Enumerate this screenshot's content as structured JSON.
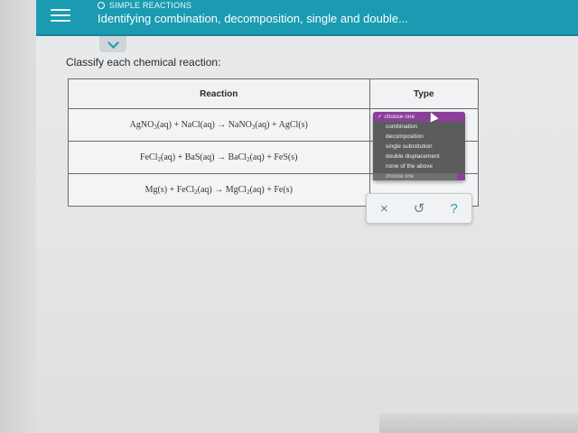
{
  "header": {
    "topic_label": "SIMPLE REACTIONS",
    "title": "Identifying combination, decomposition, single and double..."
  },
  "instruction": "Classify each chemical reaction:",
  "table": {
    "headers": {
      "reaction": "Reaction",
      "type": "Type"
    },
    "rows": [
      {
        "parts": [
          "AgNO",
          "3",
          "(aq)",
          "+",
          "NaCl(aq)",
          "→",
          "NaNO",
          "3",
          "(aq)",
          "+",
          "AgCl(s)"
        ],
        "type_value": "choose one"
      },
      {
        "parts": [
          "FeCl",
          "2",
          "(aq)",
          "+",
          "BaS(aq)",
          "→",
          "BaCl",
          "2",
          "(aq)",
          "+",
          "FeS(s)"
        ],
        "type_value": "choose one"
      },
      {
        "parts": [
          "Mg(s)",
          "+",
          "FeCl",
          "2",
          "(aq)",
          "→",
          "MgCl",
          "2",
          "(aq)",
          "+",
          "Fe(s)"
        ],
        "type_value": "choose one"
      }
    ]
  },
  "dropdown": {
    "options": [
      "choose one",
      "combination",
      "decomposition",
      "single substitution",
      "double displacement",
      "none of the above"
    ],
    "selected": "choose one",
    "check_icon": "✓",
    "under_label": "choose one"
  },
  "actions": {
    "clear": "×",
    "undo": "↺",
    "help": "?"
  },
  "colors": {
    "accent": "#1b9bb1",
    "dropdown_selected": "#8b3f98",
    "dropdown_bg": "#5b5c5e"
  }
}
